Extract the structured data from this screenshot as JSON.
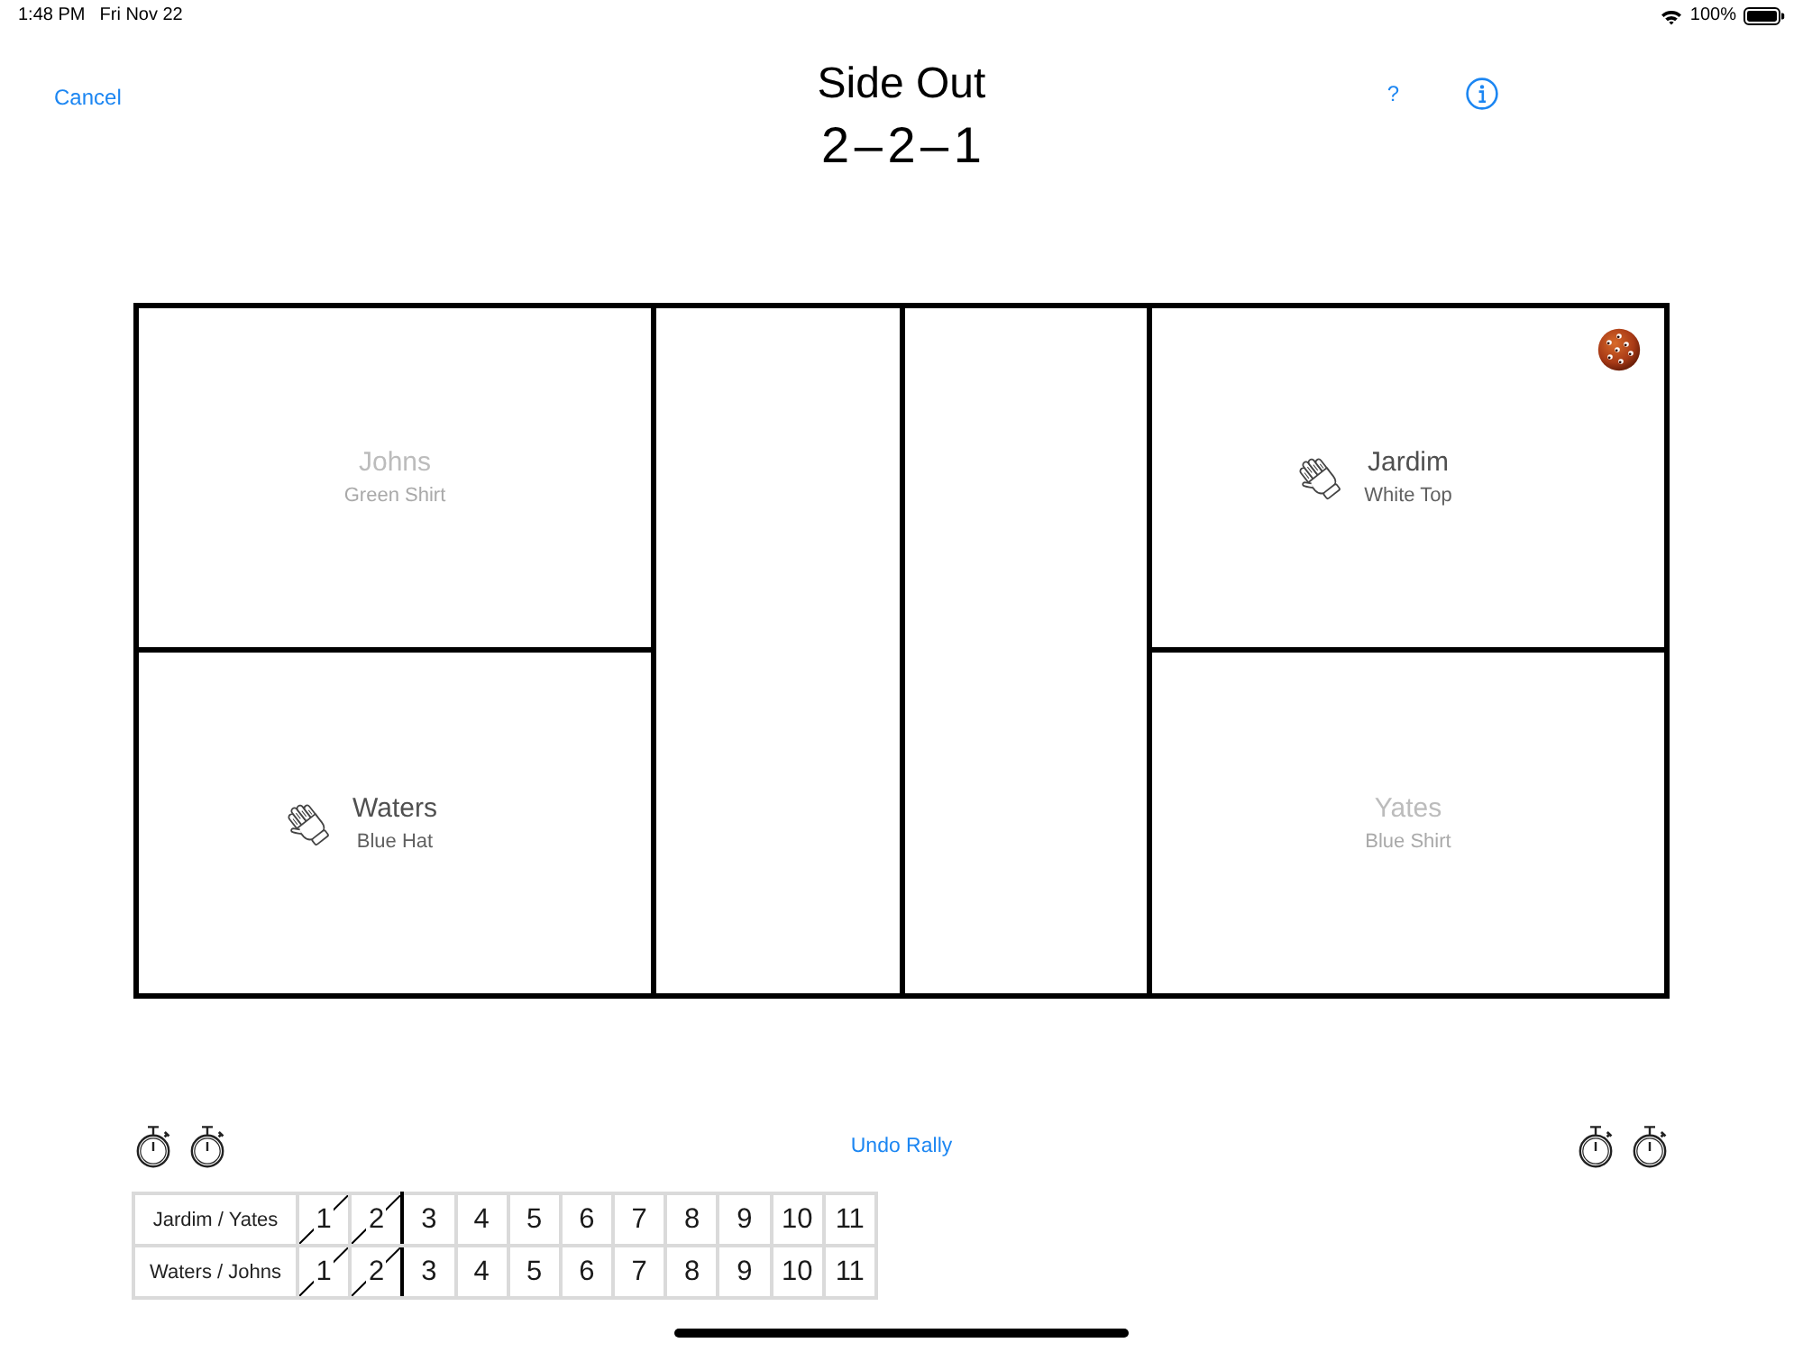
{
  "status_bar": {
    "time": "1:48 PM",
    "date": "Fri Nov 22",
    "battery": "100%"
  },
  "nav_bar": {
    "cancel": "Cancel",
    "help": "?"
  },
  "header": {
    "title": "Side Out",
    "score": "2 – 2 – 1"
  },
  "court": {
    "sides": [
      {
        "players": [
          {
            "name": "Johns",
            "shirt": "Green Shirt",
            "active": false,
            "hand": false,
            "ball": false
          },
          {
            "name": "Waters",
            "shirt": "Blue Hat",
            "active": true,
            "hand": true,
            "ball": false
          }
        ]
      },
      {
        "players": [
          {
            "name": "Jardim",
            "shirt": "White Top",
            "active": true,
            "hand": true,
            "ball": true
          },
          {
            "name": "Yates",
            "shirt": "Blue Shirt",
            "active": false,
            "hand": false,
            "ball": false
          }
        ]
      }
    ]
  },
  "controls": {
    "undo": "Undo Rally"
  },
  "score_sheet": {
    "rows": [
      {
        "team": "Jardim / Yates",
        "points": [
          {
            "label": "1",
            "crossed": true
          },
          {
            "label": "2",
            "crossed": true
          },
          {
            "label": "3",
            "crossed": false
          },
          {
            "label": "4",
            "crossed": false
          },
          {
            "label": "5",
            "crossed": false
          },
          {
            "label": "6",
            "crossed": false
          },
          {
            "label": "7",
            "crossed": false
          },
          {
            "label": "8",
            "crossed": false
          },
          {
            "label": "9",
            "crossed": false
          },
          {
            "label": "10",
            "crossed": false
          },
          {
            "label": "11",
            "crossed": false
          }
        ]
      },
      {
        "team": "Waters / Johns",
        "points": [
          {
            "label": "1",
            "crossed": true
          },
          {
            "label": "2",
            "crossed": true
          },
          {
            "label": "3",
            "crossed": false
          },
          {
            "label": "4",
            "crossed": false
          },
          {
            "label": "5",
            "crossed": false
          },
          {
            "label": "6",
            "crossed": false
          },
          {
            "label": "7",
            "crossed": false
          },
          {
            "label": "8",
            "crossed": false
          },
          {
            "label": "9",
            "crossed": false
          },
          {
            "label": "10",
            "crossed": false
          },
          {
            "label": "11",
            "crossed": false
          }
        ]
      }
    ]
  }
}
